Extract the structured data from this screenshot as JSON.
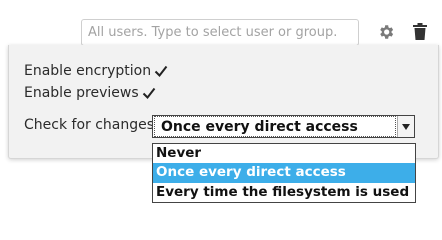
{
  "share_with": {
    "placeholder": "All users. Type to select user or group."
  },
  "actions": {
    "settings_icon": "gear-icon",
    "delete_icon": "trash-icon"
  },
  "options": {
    "encryption": {
      "label": "Enable encryption",
      "checked": true
    },
    "previews": {
      "label": "Enable previews",
      "checked": true
    },
    "check_changes": {
      "label": "Check for changes",
      "selected": "Once every direct access",
      "choices": [
        "Never",
        "Once every direct access",
        "Every time the filesystem is used"
      ],
      "highlighted_index": 1
    }
  },
  "colors": {
    "highlight": "#3daee9",
    "panel_bg": "#f2f2f2",
    "icon_gray": "#7a7a7a"
  }
}
